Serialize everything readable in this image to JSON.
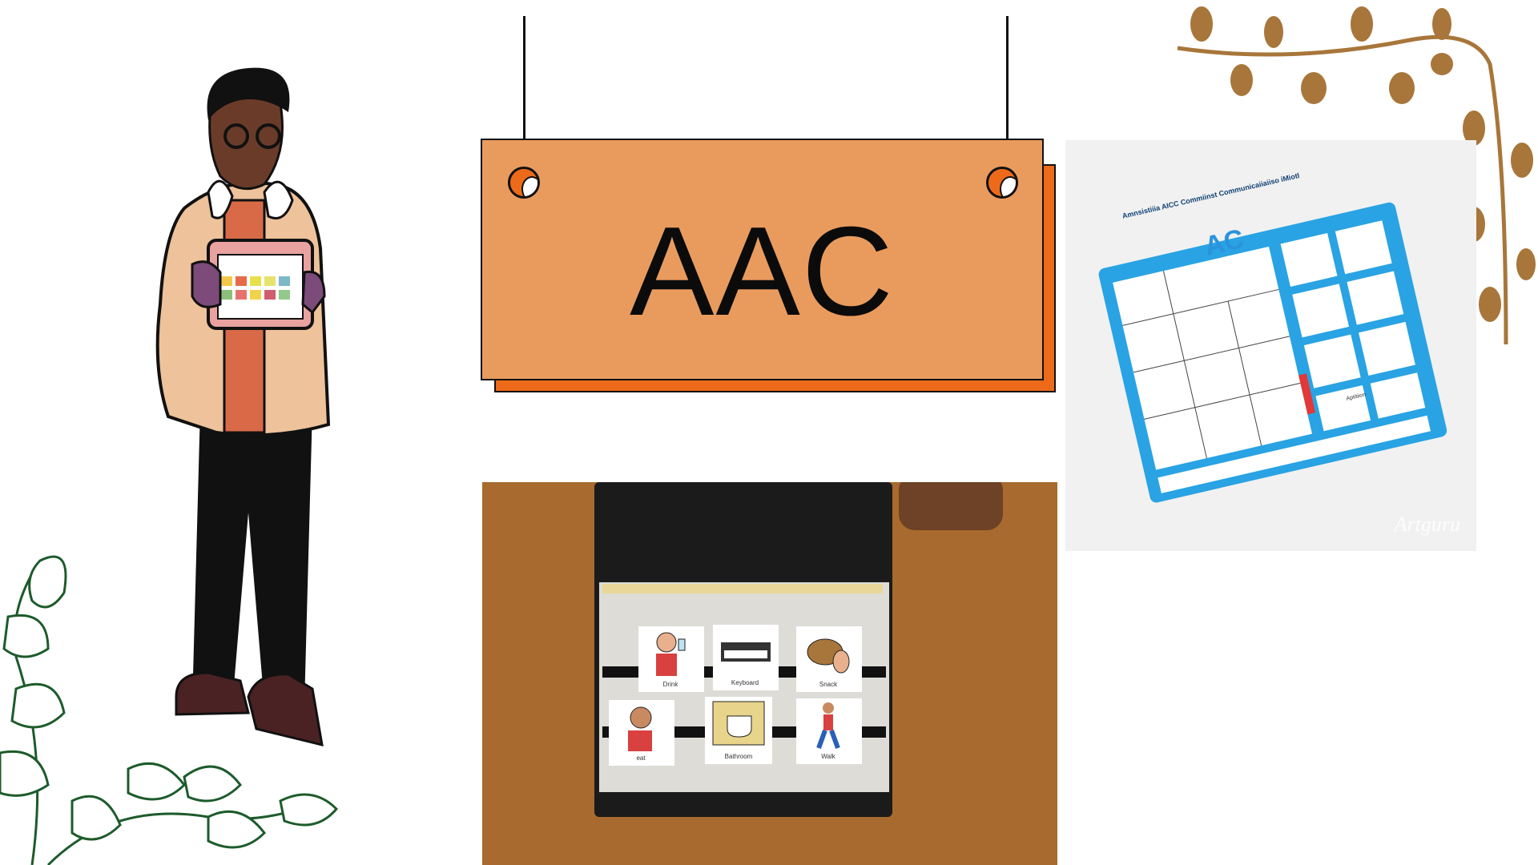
{
  "sign": {
    "title": "AAC"
  },
  "binder_photo": {
    "cards": [
      {
        "label": "Drink",
        "icon": "drinking-person-icon"
      },
      {
        "label": "Keyboard",
        "icon": "keyboard-icon"
      },
      {
        "label": "Snack",
        "icon": "pretzel-icon"
      },
      {
        "label": "eat",
        "icon": "eating-person-icon"
      },
      {
        "label": "Bathroom",
        "icon": "toilet-icon"
      },
      {
        "label": "Walk",
        "icon": "walking-person-icon"
      }
    ]
  },
  "board_photo": {
    "header": "Amnsistiiia AICC Commiinst Communicaiiaiiso iMiotl",
    "logo": "AC",
    "footer_label": "Aptitiion",
    "watermark": "Artguru"
  },
  "colors": {
    "sign_face": "#e99b5e",
    "sign_shadow": "#ec6a1a",
    "vine_brown": "#a8763a",
    "vine_green": "#1d5b2b",
    "board_blue": "#29a3e3"
  }
}
